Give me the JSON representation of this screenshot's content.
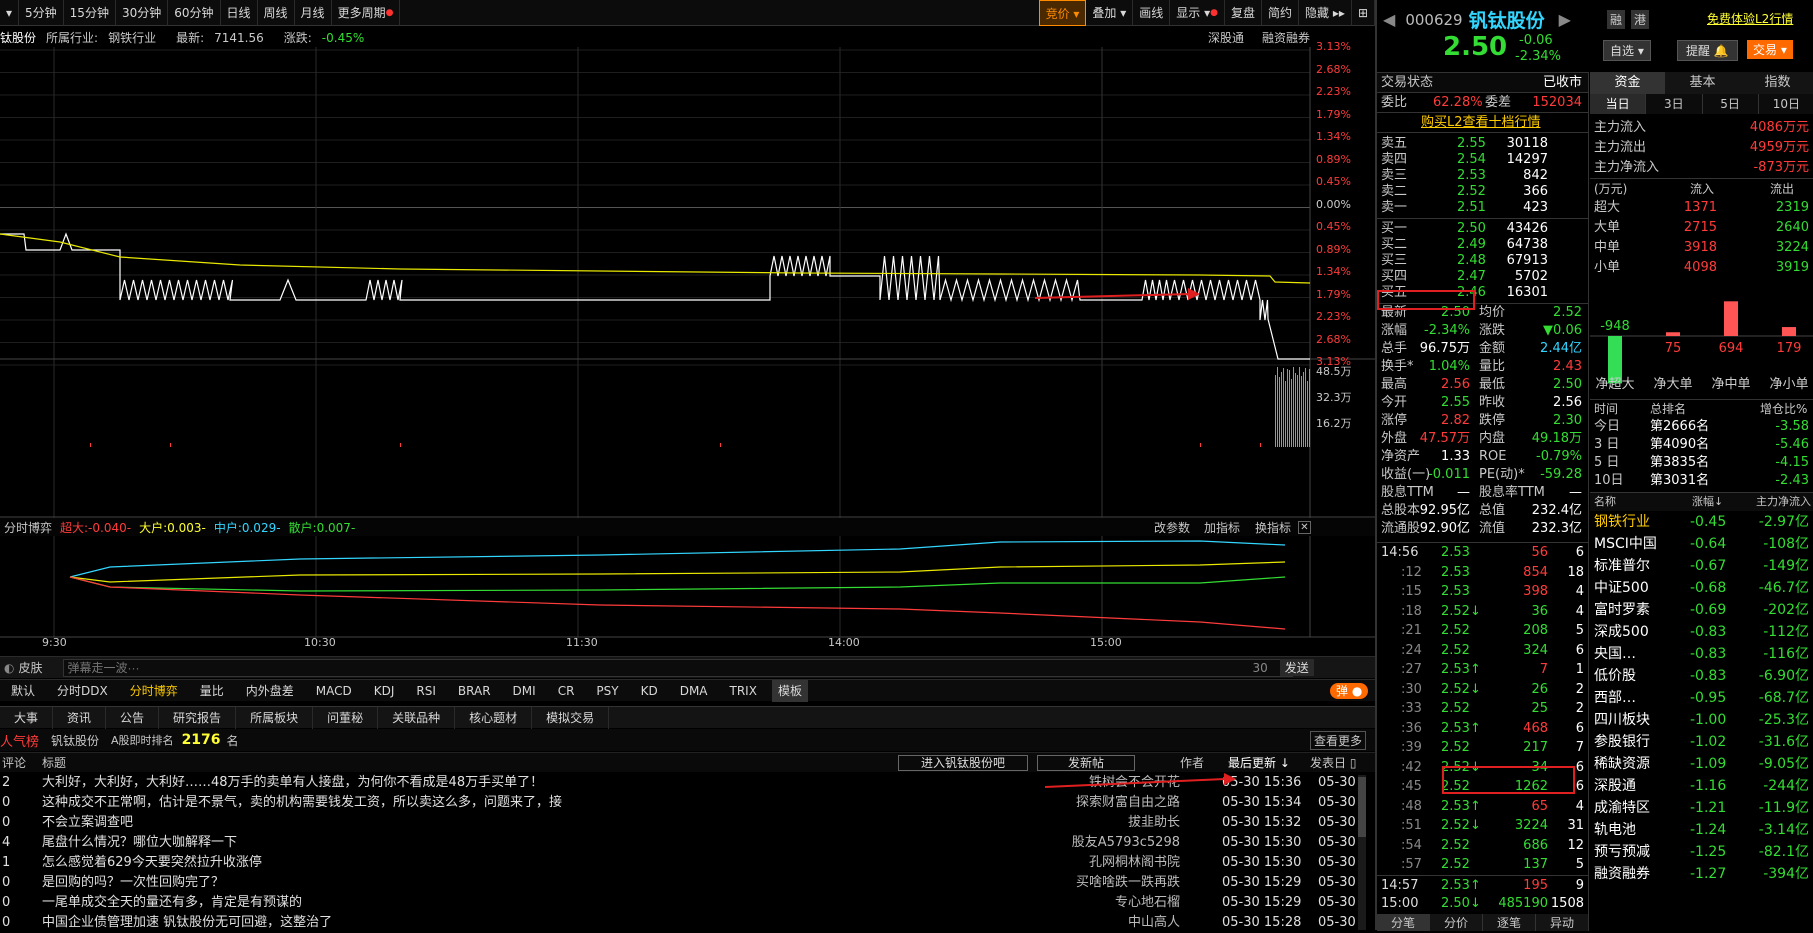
{
  "toolbar": {
    "items": [
      "5分钟",
      "15分钟",
      "30分钟",
      "60分钟",
      "日线",
      "周线",
      "月线",
      "更多周期"
    ],
    "right": [
      "竞价",
      "叠加",
      "画线",
      "显示",
      "复盘",
      "简约",
      "隐藏"
    ]
  },
  "info": {
    "name": "钛股份",
    "industry_label": "所属行业:",
    "industry": "钢铁行业",
    "latest_label": "最新:",
    "latest": "7141.56",
    "chg_label": "涨跌:",
    "chg": "-0.45%",
    "link1": "深股通",
    "link2": "融资融券"
  },
  "axis": {
    "right": [
      "3.13%",
      "2.68%",
      "2.23%",
      "1.79%",
      "1.34%",
      "0.89%",
      "0.45%",
      "0.00%",
      "0.45%",
      "0.89%",
      "1.34%",
      "1.79%",
      "2.23%",
      "2.68%",
      "3.13%"
    ],
    "vol": [
      "48.5万",
      "32.3万",
      "16.2万"
    ],
    "time": [
      "9:30",
      "10:30",
      "11:30",
      "14:00",
      "15:00"
    ]
  },
  "indicator": {
    "name": "分时博弈",
    "super": "超大:-0.040-",
    "big": "大户:0.003-",
    "mid": "中户:0.029-",
    "small": "散户:0.007-",
    "btn1": "改参数",
    "btn2": "加指标",
    "btn3": "换指标"
  },
  "danmu": {
    "skin": "皮肤",
    "placeholder": "弹幕走一波···",
    "count": "30",
    "send": "发送"
  },
  "ind_tabs": [
    "默认",
    "分时DDX",
    "分时博弈",
    "量比",
    "内外盘差",
    "MACD",
    "KDJ",
    "RSI",
    "BRAR",
    "DMI",
    "CR",
    "PSY",
    "KD",
    "DMA",
    "TRIX",
    "模板"
  ],
  "dan_toggle": "弹",
  "news_tabs": [
    "大事",
    "资讯",
    "公告",
    "研究报告",
    "所属板块",
    "问董秘",
    "关联品种",
    "核心题材",
    "模拟交易"
  ],
  "rank": {
    "label": "人气榜",
    "stock": "钒钛股份",
    "rank_label": "A股即时排名",
    "rank": "2176",
    "unit": "名",
    "more": "查看更多"
  },
  "news_head": {
    "c1": "评论",
    "c2": "标题",
    "b1": "进入钒钛股份吧",
    "b2": "发新帖",
    "author": "作者",
    "updated": "最后更新",
    "posted": "发表日"
  },
  "news": [
    {
      "n": "2",
      "t": "大利好，大利好，大利好……48万手的卖单有人接盘，为何你不看成是48万手买单了！",
      "a": "铁树会不会开花",
      "u": "05-30  15:36",
      "d": "05-30"
    },
    {
      "n": "0",
      "t": "这种成交不正常啊，估计是不景气，卖的机构需要钱发工资，所以卖这么多，问题来了，接",
      "a": "探索财富自由之路",
      "u": "05-30  15:34",
      "d": "05-30"
    },
    {
      "n": "0",
      "t": "不会立案调查吧",
      "a": "拔韭助长",
      "u": "05-30  15:32",
      "d": "05-30"
    },
    {
      "n": "4",
      "t": "尾盘什么情况？哪位大咖解释一下",
      "a": "股友A5793c5298",
      "u": "05-30  15:30",
      "d": "05-30"
    },
    {
      "n": "1",
      "t": "怎么感觉着629今天要突然拉升收涨停",
      "a": "孔网桐林阁书院",
      "u": "05-30  15:30",
      "d": "05-30"
    },
    {
      "n": "0",
      "t": "是回购的吗？一次性回购完了？",
      "a": "买啥啥跌一跌再跌",
      "u": "05-30  15:29",
      "d": "05-30"
    },
    {
      "n": "0",
      "t": "一尾单成交全天的量还有多，肯定是有预谋的",
      "a": "专心地石榴",
      "u": "05-30  15:29",
      "d": "05-30"
    },
    {
      "n": "0",
      "t": "中国企业债管理加速 钒钛股份无可回避，这整治了",
      "a": "中山高人",
      "u": "05-30  15:28",
      "d": "05-30"
    }
  ],
  "stock": {
    "code": "000629",
    "name": "钒钛股份",
    "price": "2.50",
    "chg": "-0.06",
    "pct": "-2.34%",
    "btn_rong": "融",
    "btn_gang": "港",
    "promo": "免费体验L2行情",
    "zixuan": "自选",
    "tixing": "提醒",
    "jiaoyi": "交易"
  },
  "status": {
    "label": "交易状态",
    "value": "已收市",
    "wb_label": "委比",
    "wb": "62.28%",
    "wc_label": "委差",
    "wc": "152034",
    "l2": "购买L2查看十档行情"
  },
  "asks": [
    [
      "卖五",
      "2.55",
      "30118"
    ],
    [
      "卖四",
      "2.54",
      "14297"
    ],
    [
      "卖三",
      "2.53",
      "842"
    ],
    [
      "卖二",
      "2.52",
      "366"
    ],
    [
      "卖一",
      "2.51",
      "423"
    ]
  ],
  "bids": [
    [
      "买一",
      "2.50",
      "43426"
    ],
    [
      "买二",
      "2.49",
      "64738"
    ],
    [
      "买三",
      "2.48",
      "67913"
    ],
    [
      "买四",
      "2.47",
      "5702"
    ],
    [
      "买五",
      "2.46",
      "16301"
    ]
  ],
  "quote": [
    [
      "最新",
      "2.50",
      "均价",
      "2.52"
    ],
    [
      "涨幅",
      "-2.34%",
      "涨跌",
      "▼0.06"
    ],
    [
      "总手",
      "96.75万",
      "金额",
      "2.44亿"
    ],
    [
      "换手*",
      "1.04%",
      "量比",
      "2.43"
    ],
    [
      "最高",
      "2.56",
      "最低",
      "2.50"
    ],
    [
      "今开",
      "2.55",
      "昨收",
      "2.56"
    ],
    [
      "涨停",
      "2.82",
      "跌停",
      "2.30"
    ],
    [
      "外盘",
      "47.57万",
      "内盘",
      "49.18万"
    ],
    [
      "净资产",
      "1.33",
      "ROE",
      "-0.79%"
    ],
    [
      "收益(一)",
      "-0.011",
      "PE(动)*",
      "-59.28"
    ],
    [
      "股息TTM",
      "—",
      "股息率TTM",
      "—"
    ],
    [
      "总股本",
      "92.95亿",
      "总值",
      "232.4亿"
    ],
    [
      "流通股",
      "92.90亿",
      "流值",
      "232.3亿"
    ]
  ],
  "ticks": [
    [
      "14:56",
      "2.53",
      "56",
      "6"
    ],
    [
      ":12",
      "2.53",
      "854",
      "18"
    ],
    [
      ":15",
      "2.53",
      "398",
      "4"
    ],
    [
      ":18",
      "2.52↓",
      "36",
      "4"
    ],
    [
      ":21",
      "2.52",
      "208",
      "5"
    ],
    [
      ":24",
      "2.52",
      "324",
      "6"
    ],
    [
      ":27",
      "2.53↑",
      "7",
      "1"
    ],
    [
      ":30",
      "2.52↓",
      "26",
      "2"
    ],
    [
      ":33",
      "2.52",
      "25",
      "2"
    ],
    [
      ":36",
      "2.53↑",
      "468",
      "6"
    ],
    [
      ":39",
      "2.52",
      "217",
      "7"
    ],
    [
      ":42",
      "2.52↓",
      "34",
      "6"
    ],
    [
      ":45",
      "2.52",
      "1262",
      "6"
    ],
    [
      ":48",
      "2.53↑",
      "65",
      "4"
    ],
    [
      ":51",
      "2.52↓",
      "3224",
      "31"
    ],
    [
      ":54",
      "2.52",
      "686",
      "12"
    ],
    [
      ":57",
      "2.52",
      "137",
      "5"
    ],
    [
      "14:57",
      "2.53↑",
      "195",
      "9"
    ],
    [
      "15:00",
      "2.50↓",
      "485190",
      "1508"
    ]
  ],
  "bottom_tabs": [
    "分笔",
    "分价",
    "逐笔",
    "异动"
  ],
  "fund": {
    "tabs": [
      "资金",
      "基本",
      "指数"
    ],
    "periods": [
      "当日",
      "3日",
      "5日",
      "10日"
    ],
    "flow": [
      [
        "主力流入",
        "4086万元"
      ],
      [
        "主力流出",
        "4959万元"
      ],
      [
        "主力净流入",
        "-873万元"
      ]
    ],
    "head": [
      "(万元)",
      "流入",
      "流出"
    ],
    "rows": [
      [
        "超大",
        "1371",
        "2319"
      ],
      [
        "大单",
        "2715",
        "2640"
      ],
      [
        "中单",
        "3918",
        "3224"
      ],
      [
        "小单",
        "4098",
        "3919"
      ]
    ]
  },
  "chart_data": {
    "type": "bar",
    "categories": [
      "净超大",
      "净大单",
      "净中单",
      "净小单"
    ],
    "values": [
      -948,
      75,
      694,
      179
    ],
    "ylim": [
      -1000,
      750
    ]
  },
  "rankings": {
    "head": [
      "时间",
      "总排名",
      "增仓比%"
    ],
    "rows": [
      [
        "今日",
        "第2666名",
        "-3.58"
      ],
      [
        "3 日",
        "第4090名",
        "-5.46"
      ],
      [
        "5 日",
        "第3835名",
        "-4.15"
      ],
      [
        "10日",
        "第3031名",
        "-2.43"
      ]
    ]
  },
  "sectors": {
    "head": [
      "名称",
      "涨幅↓",
      "主力净流入"
    ],
    "rows": [
      [
        "钢铁行业",
        "-0.45",
        "-2.97亿"
      ],
      [
        "MSCI中国",
        "-0.64",
        "-108亿"
      ],
      [
        "标准普尔",
        "-0.67",
        "-149亿"
      ],
      [
        "中证500",
        "-0.68",
        "-46.7亿"
      ],
      [
        "富时罗素",
        "-0.69",
        "-202亿"
      ],
      [
        "深成500",
        "-0.83",
        "-112亿"
      ],
      [
        "央国…",
        "-0.83",
        "-116亿"
      ],
      [
        "低价股",
        "-0.83",
        "-6.90亿"
      ],
      [
        "西部…",
        "-0.95",
        "-68.7亿"
      ],
      [
        "四川板块",
        "-1.00",
        "-25.3亿"
      ],
      [
        "参股银行",
        "-1.02",
        "-31.6亿"
      ],
      [
        "稀缺资源",
        "-1.09",
        "-9.05亿"
      ],
      [
        "深股通",
        "-1.16",
        "-244亿"
      ],
      [
        "成渝特区",
        "-1.21",
        "-11.9亿"
      ],
      [
        "轨电池",
        "-1.24",
        "-3.14亿"
      ],
      [
        "预亏预减",
        "-1.25",
        "-82.1亿"
      ],
      [
        "融资融券",
        "-1.27",
        "-394亿"
      ]
    ]
  },
  "colors": {
    "up": "#ff3b3b",
    "down": "#33dd33",
    "accent": "#ff8c00",
    "price_line": "#ffffff",
    "avg_line": "#e8e800"
  }
}
